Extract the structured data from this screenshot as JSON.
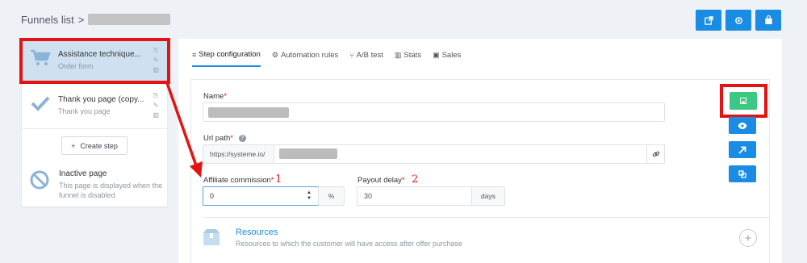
{
  "breadcrumb": {
    "root": "Funnels list",
    "separator": ">"
  },
  "header_icons": [
    "external-link-icon",
    "settings-icon",
    "shopping-bag-icon"
  ],
  "steps": [
    {
      "title": "Assistance technique...",
      "subtitle": "Order form",
      "icon": "cart-icon",
      "active": true
    },
    {
      "title": "Thank you page (copy...",
      "subtitle": "Thank you page",
      "icon": "check-icon",
      "active": false
    }
  ],
  "create_step": {
    "icon": "+",
    "label": "Create step"
  },
  "inactive_page": {
    "title": "Inactive page",
    "subtitle": "This page is displayed when the funnel is disabled"
  },
  "tabs": [
    {
      "icon": "≡",
      "label": "Step configuration",
      "active": true
    },
    {
      "icon": "⚙",
      "label": "Automation rules",
      "active": false
    },
    {
      "icon": "⑂",
      "label": "A/B test",
      "active": false
    },
    {
      "icon": "▥",
      "label": "Stats",
      "active": false
    },
    {
      "icon": "▣",
      "label": "Sales",
      "active": false
    }
  ],
  "form": {
    "name_label": "Name",
    "required_mark": "*",
    "url_label": "Url path",
    "url_prefix": "https://systeme.io/",
    "affiliate_label": "Affiliate commission",
    "affiliate_value": "0",
    "affiliate_unit": "%",
    "payout_label": "Payout delay",
    "payout_value": "30",
    "payout_unit": "days"
  },
  "annotations": {
    "first": "1",
    "second": "2"
  },
  "colors": {
    "primary": "#1a8ce4",
    "success": "#3cc882",
    "highlight": "#e31313",
    "active_step": "#cfe1f0"
  },
  "resources": {
    "title": "Resources",
    "subtitle": "Resources to which the customer will have access after offer purchase"
  }
}
